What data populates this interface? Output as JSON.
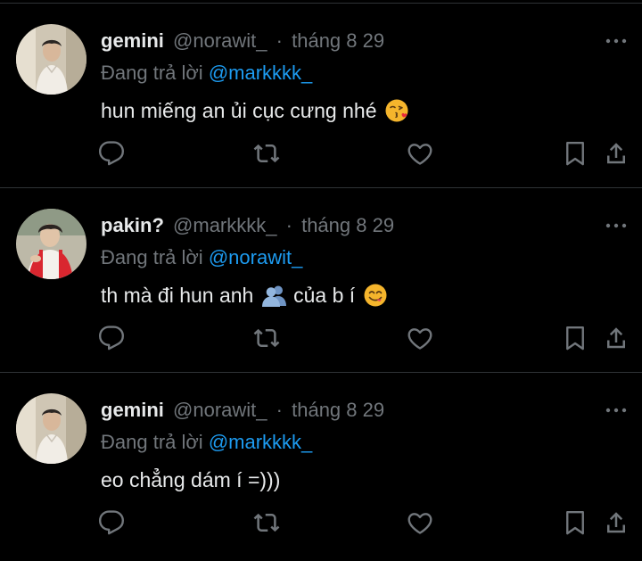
{
  "colors": {
    "background": "#000000",
    "primary_text": "#e7e9ea",
    "secondary_text": "#71767b",
    "link": "#1d9bf0",
    "divider": "#2f3336"
  },
  "tweets": [
    {
      "display_name": "gemini",
      "handle": "@norawit_",
      "separator": "·",
      "date": "tháng 8 29",
      "reply_prefix": "Đang trả lời",
      "reply_to": "@markkkk_",
      "text": "hun miếng an ủi cục cưng nhé",
      "emoji": "face-blowing-kiss-emoji",
      "icons": [
        "more-icon",
        "reply-icon",
        "retweet-icon",
        "like-icon",
        "bookmark-icon",
        "share-icon"
      ]
    },
    {
      "display_name": "pakin?",
      "handle": "@markkkk_",
      "separator": "·",
      "date": "tháng 8 29",
      "reply_prefix": "Đang trả lời",
      "reply_to": "@norawit_",
      "text_before": "th mà đi hun anh",
      "text_after": "của b í",
      "emoji_mid": "busts-in-silhouette-emoji",
      "emoji": "face-savoring-food-emoji",
      "icons": [
        "more-icon",
        "reply-icon",
        "retweet-icon",
        "like-icon",
        "bookmark-icon",
        "share-icon"
      ]
    },
    {
      "display_name": "gemini",
      "handle": "@norawit_",
      "separator": "·",
      "date": "tháng 8 29",
      "reply_prefix": "Đang trả lời",
      "reply_to": "@markkkk_",
      "text": "eo chẳng dám í =)))",
      "icons": [
        "more-icon",
        "reply-icon",
        "retweet-icon",
        "like-icon",
        "bookmark-icon",
        "share-icon"
      ]
    }
  ]
}
